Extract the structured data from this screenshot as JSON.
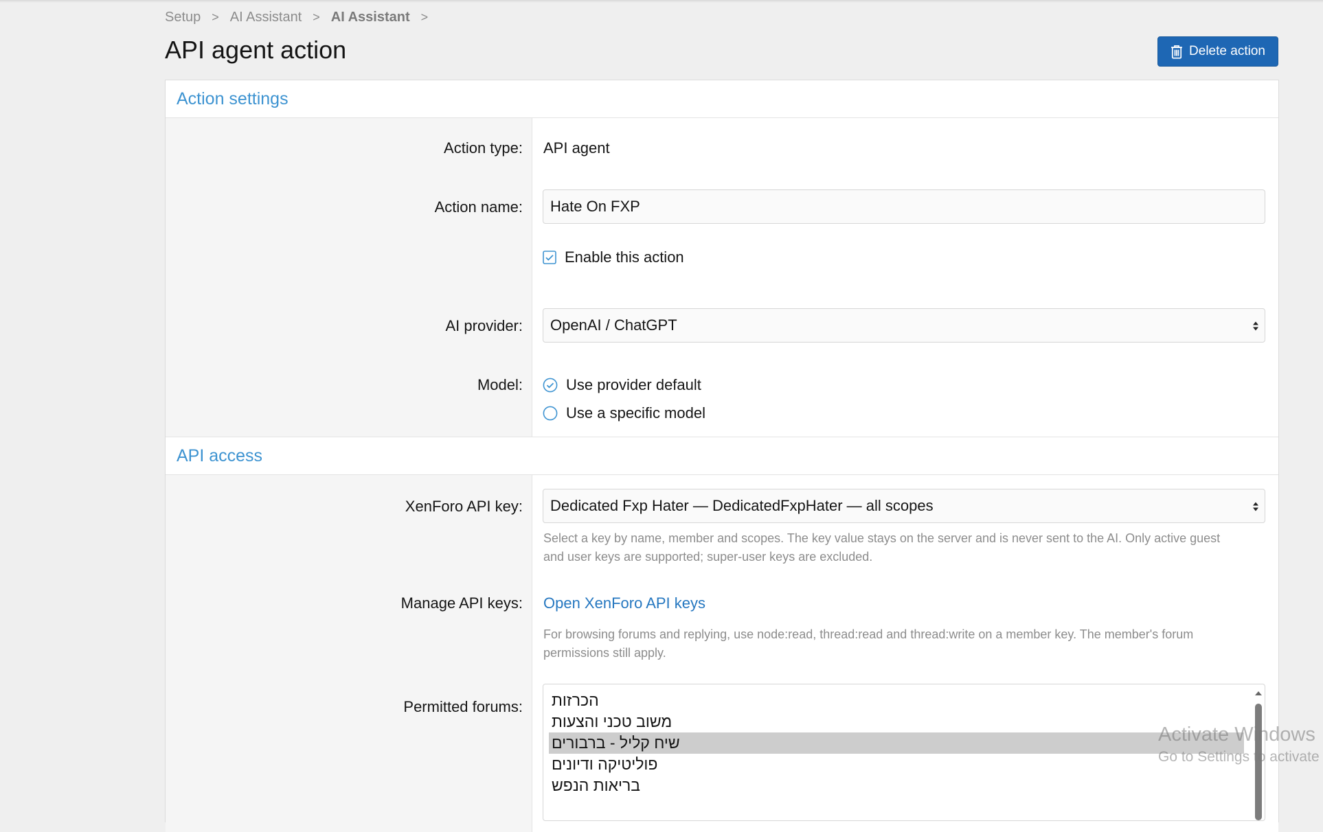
{
  "breadcrumb": {
    "items": [
      "Setup",
      "AI Assistant",
      "AI Assistant"
    ],
    "separator": ">"
  },
  "page": {
    "title": "API agent action",
    "delete_button_label": "Delete action"
  },
  "sections": {
    "action_settings": {
      "title": "Action settings",
      "action_type_label": "Action type:",
      "action_type_value": "API agent",
      "action_name_label": "Action name:",
      "action_name_value": "Hate On FXP",
      "enable_label": "Enable this action",
      "enable_checked": true,
      "ai_provider_label": "AI provider:",
      "ai_provider_value": "OpenAI / ChatGPT",
      "model_label": "Model:",
      "model_options": [
        "Use provider default",
        "Use a specific model"
      ],
      "model_selected": "Use provider default"
    },
    "api_access": {
      "title": "API access",
      "api_key_label": "XenForo API key:",
      "api_key_value": "Dedicated Fxp Hater — DedicatedFxpHater — all scopes",
      "api_key_hint_line1": "Select a key by name, member and scopes. The key value stays on the server and is never sent to the AI. Only active guest",
      "api_key_hint_line2": "and user keys are supported; super-user keys are excluded.",
      "manage_label": "Manage API keys:",
      "manage_link": "Open XenForo API keys",
      "manage_hint_line1": "For browsing forums and replying, use node:read, thread:read and thread:write on a member key. The member's forum",
      "manage_hint_line2": "permissions still apply.",
      "forums_label": "Permitted forums:",
      "forums": [
        "הכרזות",
        "משוב טכני והצעות",
        "שיח קליל - ברבורים",
        "פוליטיקה ודיונים",
        "בריאות הנפש"
      ],
      "forums_selected": "שיח קליל - ברבורים"
    }
  },
  "watermark": {
    "line1": "Activate Windows",
    "line2": "Go to Settings to activate Windows."
  },
  "colors": {
    "accent": "#1e67b4",
    "section_title": "#3d93d1",
    "link": "#2577c0",
    "hint": "#8c8c8c"
  },
  "icons": {
    "delete": "trash-icon",
    "checkbox": "checkbox-checked-icon",
    "radio_on": "radio-checked-icon",
    "radio_off": "radio-unchecked-icon",
    "select": "select-arrows-icon"
  }
}
